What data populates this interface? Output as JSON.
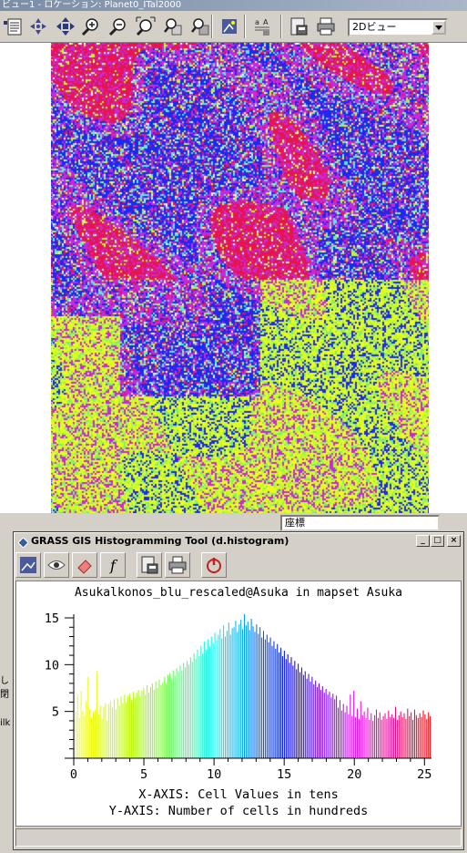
{
  "main_window": {
    "title": "ビュー1 - ロケーション: Planet0_ITal2000",
    "view_mode": "2Dビュー",
    "toolbar_icons": [
      "display-icon",
      "pointer-icon",
      "pan-icon",
      "zoom-in-icon",
      "zoom-out-icon",
      "zoom-extent-icon",
      "zoom-back-icon",
      "zoom-region-icon",
      "query-icon",
      "layer-info-icon",
      "save-display-icon",
      "print-icon"
    ],
    "partial_coordinate_label": "座標",
    "left_edge_fragments": [
      "し",
      "閉",
      "ilk"
    ]
  },
  "histogram_window": {
    "title": "GRASS GIS Histogramming Tool (d.histogram)",
    "window_buttons": {
      "minimize": "_",
      "maximize": "□",
      "close": "×"
    },
    "toolbar_icons": [
      "display-icon",
      "eye-icon",
      "eraser-icon",
      "function-icon",
      "save-display-icon",
      "print-icon",
      "power-icon"
    ],
    "function_label": "f",
    "status_text": ""
  },
  "chart_data": {
    "type": "bar",
    "title": "Asukalkonos_blu_rescaled@Asuka in mapset Asuka",
    "xlabel": "X-AXIS: Cell Values in tens",
    "ylabel": "Y-AXIS: Number of cells in hundreds",
    "xlim": [
      0,
      25.5
    ],
    "ylim": [
      0,
      15
    ],
    "xticks": [
      "0",
      "5",
      "10",
      "15",
      "20",
      "25"
    ],
    "yticks": [
      "5",
      "10",
      "15"
    ],
    "grid": false,
    "colormap": [
      "#ffff00",
      "#a0ff00",
      "#00ffff",
      "#0000ff",
      "#ff00ff",
      "#ff0000"
    ],
    "values": [
      4.1,
      5.0,
      6.8,
      4.3,
      7.2,
      5.1,
      4.6,
      6.1,
      8.7,
      5.3,
      4.4,
      4.9,
      5.2,
      9.3,
      4.7,
      5.6,
      4.2,
      5.5,
      5.9,
      4.0,
      5.8,
      6.1,
      5.4,
      6.3,
      5.2,
      6.4,
      5.6,
      6.6,
      5.9,
      6.8,
      6.0,
      6.7,
      6.9,
      6.2,
      7.1,
      6.5,
      7.0,
      7.3,
      6.6,
      7.2,
      7.5,
      6.8,
      7.8,
      7.0,
      7.6,
      8.0,
      7.3,
      8.2,
      7.5,
      8.4,
      7.8,
      8.1,
      8.7,
      8.0,
      8.9,
      9.1,
      8.5,
      9.4,
      8.8,
      9.6,
      9.3,
      9.9,
      9.4,
      10.2,
      9.7,
      10.4,
      10.0,
      10.8,
      10.3,
      11.2,
      10.6,
      11.6,
      10.9,
      12.0,
      11.2,
      12.5,
      11.6,
      12.7,
      12.0,
      13.0,
      12.3,
      13.4,
      12.6,
      13.2,
      13.8,
      12.8,
      14.2,
      13.0,
      13.6,
      14.5,
      13.2,
      13.9,
      14.0,
      14.7,
      13.5,
      14.3,
      14.8,
      13.8,
      15.4,
      14.2,
      14.6,
      13.7,
      14.9,
      14.1,
      13.5,
      14.3,
      13.3,
      14.0,
      12.9,
      13.6,
      12.7,
      13.2,
      12.4,
      12.9,
      12.0,
      12.5,
      11.7,
      12.2,
      11.3,
      11.8,
      10.9,
      11.5,
      10.6,
      11.1,
      10.2,
      10.8,
      9.9,
      10.4,
      9.5,
      10.1,
      9.2,
      9.7,
      8.9,
      9.3,
      8.5,
      9.0,
      8.2,
      8.7,
      7.9,
      8.3,
      7.6,
      8.0,
      7.3,
      7.7,
      7.0,
      7.4,
      6.8,
      7.1,
      6.5,
      6.9,
      6.3,
      6.7,
      5.4,
      6.2,
      5.1,
      5.8,
      4.9,
      5.6,
      4.7,
      6.8,
      4.5,
      7.2,
      4.4,
      5.3,
      4.2,
      6.1,
      4.6,
      5.0,
      4.3,
      5.4,
      4.1,
      4.8,
      4.0,
      4.6,
      5.2,
      4.3,
      4.9,
      4.1,
      4.5,
      4.8,
      4.2,
      5.1,
      4.4,
      4.7,
      4.3,
      5.5,
      4.1,
      4.6,
      5.0,
      4.4,
      4.8,
      4.2,
      5.3,
      4.5,
      4.9,
      4.1,
      5.2,
      4.6,
      4.3,
      4.8,
      4.4,
      5.1,
      4.7,
      4.2,
      4.9,
      4.5
    ]
  }
}
